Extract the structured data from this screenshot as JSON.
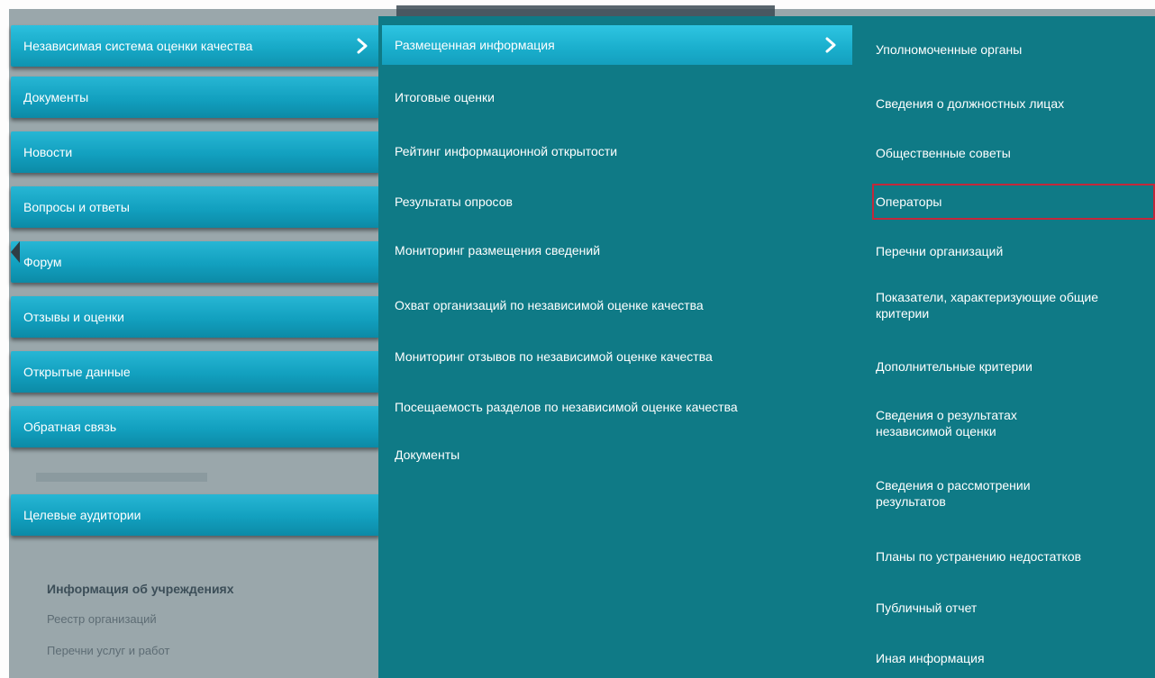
{
  "background_heading": "",
  "left_menu": [
    {
      "label": "Независимая система оценки качества",
      "active": true
    },
    {
      "label": "Документы"
    },
    {
      "label": "Новости"
    },
    {
      "label": "Вопросы и ответы"
    },
    {
      "label": "Форум"
    },
    {
      "label": "Отзывы и оценки"
    },
    {
      "label": "Открытые данные"
    },
    {
      "label": "Обратная связь"
    },
    {
      "label": "Целевые аудитории"
    }
  ],
  "left_sub": {
    "title": "Информация об учреждениях",
    "items": [
      "Реестр организаций",
      "Перечни услуг и работ"
    ]
  },
  "middle_menu": {
    "header": "Размещенная информация",
    "items": [
      "Итоговые оценки",
      "Рейтинг информационной открытости",
      "Результаты опросов",
      "Мониторинг размещения сведений",
      "Охват организаций по независимой оценке качества",
      "Мониторинг отзывов по независимой оценке качества",
      "Посещаемость разделов по независимой оценке качества",
      "Документы"
    ]
  },
  "right_menu": {
    "items": [
      "Уполномоченные органы",
      "Сведения о должностных лицах",
      "Общественные советы",
      "Операторы",
      "Перечни организаций",
      "Показатели, характеризующие общие критерии",
      "Дополнительные критерии",
      "Сведения о результатах независимой оценки",
      "Сведения о рассмотрении результатов",
      "Планы по устранению недостатков",
      "Публичный отчет",
      "Иная информация"
    ],
    "highlighted": "Операторы"
  },
  "colors": {
    "menu_teal": "#0f7a86",
    "button_cyan": "#1aaecc",
    "highlight_red": "#c2283b"
  }
}
